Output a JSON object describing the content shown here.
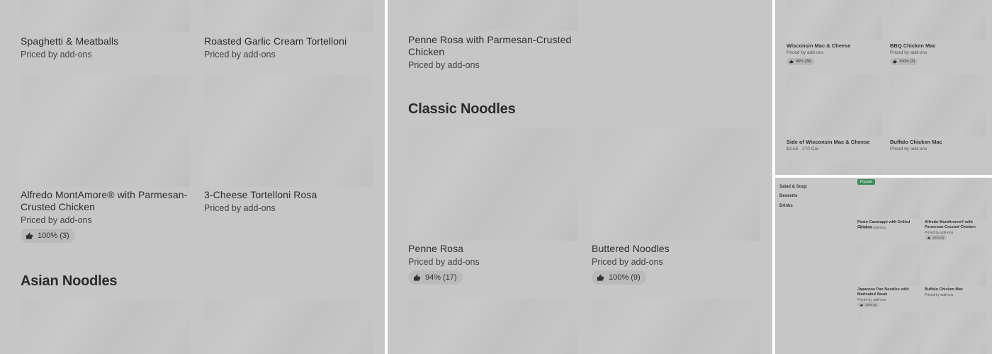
{
  "panel1": {
    "items": [
      {
        "title": "Spaghetti & Meatballs",
        "price": "Priced by add-ons"
      },
      {
        "title": "Roasted Garlic Cream Tortelloni",
        "price": "Priced by add-ons"
      },
      {
        "title": "Alfredo MontAmore® with Parmesan-Crusted Chicken",
        "price": "Priced by add-ons",
        "rating": "100% (3)"
      },
      {
        "title": "3-Cheese Tortelloni Rosa",
        "price": "Priced by add-ons"
      }
    ],
    "section_heading": "Asian Noodles"
  },
  "panel2": {
    "top_item": {
      "title": "Penne Rosa with Parmesan-Crusted Chicken",
      "price": "Priced by add-ons"
    },
    "section_heading": "Classic Noodles",
    "items": [
      {
        "title": "Penne Rosa",
        "price": "Priced by add-ons",
        "rating": "94% (17)"
      },
      {
        "title": "Buttered Noodles",
        "price": "Priced by add-ons",
        "rating": "100% (9)"
      }
    ]
  },
  "panel3": {
    "items": [
      {
        "title": "Wisconsin Mac & Cheese",
        "price": "Priced by add-ons",
        "rating": "96% (28)"
      },
      {
        "title": "BBQ Chicken Mac",
        "price": "Priced by add-ons",
        "rating": "100% (3)"
      },
      {
        "title": "Side of Wisconsin Mac & Cheese",
        "price": "$3.56",
        "calories": "270 Cal."
      },
      {
        "title": "Buffalo Chicken Mac",
        "price": "Priced by add-ons"
      }
    ]
  },
  "panel4": {
    "sidebar": [
      "Salad & Soup",
      "Desserts",
      "Drinks"
    ],
    "badge": "Popular",
    "items": [
      {
        "title": "Pesto Cavatappi with Grilled Chicken",
        "price": "Priced by add-ons"
      },
      {
        "title": "Alfredo MontAmore® with Parmesan-Crusted Chicken",
        "price": "Priced by add-ons",
        "rating": "100% (3)"
      },
      {
        "title": "Japanese Pan Noodles with Marinated Steak",
        "price": "Priced by add-ons",
        "rating": "100% (5)"
      },
      {
        "title": "Buffalo Chicken Mac",
        "price": "Priced by add-ons"
      }
    ]
  },
  "icons": {
    "rating": "thumbs-up-icon"
  }
}
